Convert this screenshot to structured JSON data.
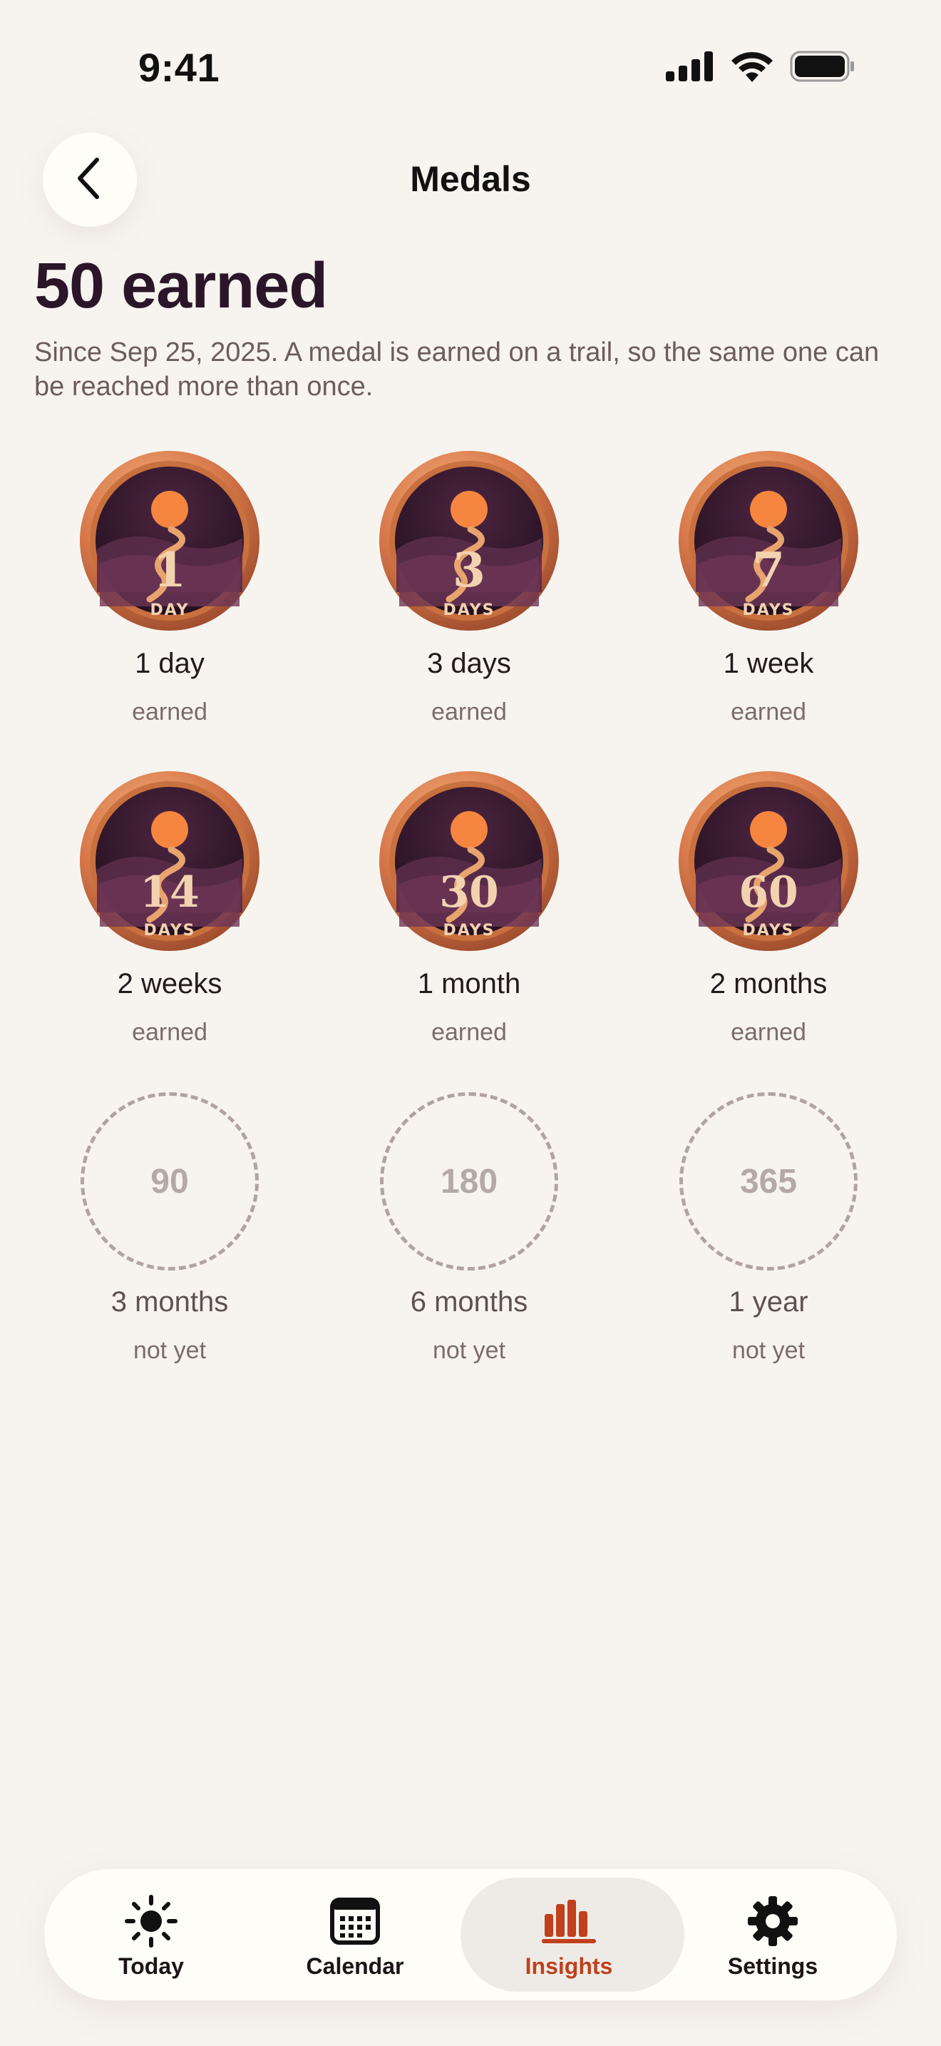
{
  "status_bar": {
    "time": "9:41",
    "icons": [
      "cellular-signal-icon",
      "wifi-icon",
      "battery-icon"
    ]
  },
  "header": {
    "back_icon": "chevron-left-icon",
    "title": "Medals"
  },
  "summary": {
    "headline": "50 earned",
    "subtitle": "Since Sep 25, 2025. A medal is earned on a trail, so the same one can be reached more than once."
  },
  "medals": [
    {
      "number": "1",
      "unit": "DAY",
      "label": "1 day",
      "status": "earned",
      "earned": true
    },
    {
      "number": "3",
      "unit": "DAYS",
      "label": "3 days",
      "status": "earned",
      "earned": true
    },
    {
      "number": "7",
      "unit": "DAYS",
      "label": "1 week",
      "status": "earned",
      "earned": true
    },
    {
      "number": "14",
      "unit": "DAYS",
      "label": "2 weeks",
      "status": "earned",
      "earned": true
    },
    {
      "number": "30",
      "unit": "DAYS",
      "label": "1 month",
      "status": "earned",
      "earned": true
    },
    {
      "number": "60",
      "unit": "DAYS",
      "label": "2 months",
      "status": "earned",
      "earned": true
    },
    {
      "number": "90",
      "label": "3 months",
      "status": "not yet",
      "earned": false
    },
    {
      "number": "180",
      "label": "6 months",
      "status": "not yet",
      "earned": false
    },
    {
      "number": "365",
      "label": "1 year",
      "status": "not yet",
      "earned": false
    }
  ],
  "colors": {
    "background": "#f7f4ef",
    "headline": "#2b1629",
    "accent": "#c0401c",
    "medal_bronze": "#e08a55",
    "medal_inner": "#3a1a33",
    "sun": "#f5853f"
  },
  "tab_bar": {
    "tabs": [
      {
        "label": "Today",
        "icon": "sun-icon",
        "active": false
      },
      {
        "label": "Calendar",
        "icon": "calendar-icon",
        "active": false
      },
      {
        "label": "Insights",
        "icon": "bar-chart-icon",
        "active": true
      },
      {
        "label": "Settings",
        "icon": "gear-icon",
        "active": false
      }
    ]
  }
}
